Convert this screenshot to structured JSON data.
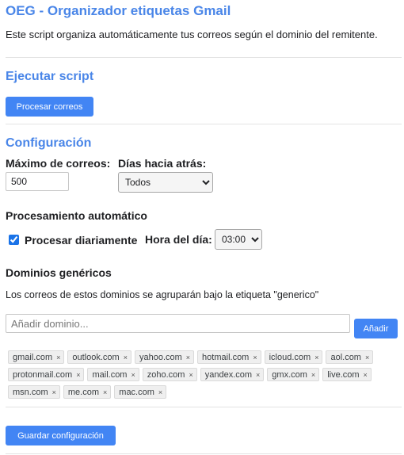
{
  "app": {
    "title": "OEG - Organizador etiquetas Gmail",
    "description": "Este script organiza automáticamente tus correos según el dominio del remitente."
  },
  "run": {
    "heading": "Ejecutar script",
    "process_button": "Procesar correos"
  },
  "config": {
    "heading": "Configuración",
    "max_emails_label": "Máximo de correos:",
    "max_emails_value": "500",
    "days_back_label": "Días hacia atrás:",
    "days_back_selected": "Todos",
    "auto_heading": "Procesamiento automático",
    "daily_checkbox_label": "Procesar diariamente",
    "daily_checked": true,
    "time_label": "Hora del día:",
    "time_selected": "03:00",
    "generic_heading": "Dominios genéricos",
    "generic_description": "Los correos de estos dominios se agruparán bajo la etiqueta \"generico\"",
    "add_domain_placeholder": "Añadir dominio...",
    "add_button": "Añadir",
    "remove_glyph": "×",
    "domains": [
      "gmail.com",
      "outlook.com",
      "yahoo.com",
      "hotmail.com",
      "icloud.com",
      "aol.com",
      "protonmail.com",
      "mail.com",
      "zoho.com",
      "yandex.com",
      "gmx.com",
      "live.com",
      "msn.com",
      "me.com",
      "mac.com"
    ],
    "save_button": "Guardar configuración"
  },
  "colors": {
    "heading_blue": "#4a86e8",
    "button_blue": "#4285f4"
  }
}
